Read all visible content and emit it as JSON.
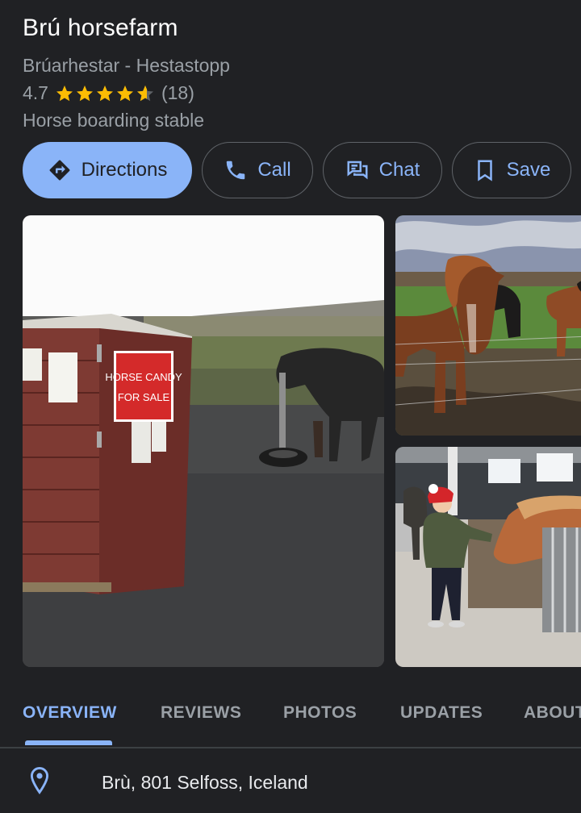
{
  "place": {
    "name": "Brú horsefarm",
    "alt_name": "Brúarhestar - Hestastopp",
    "rating": "4.7",
    "review_count": "(18)",
    "stars_filled": 4.7,
    "category": "Horse boarding stable"
  },
  "actions": {
    "directions": "Directions",
    "call": "Call",
    "chat": "Chat",
    "save": "Save"
  },
  "photos": {
    "sign_line1": "HORSE CANDY",
    "sign_line2": "FOR SALE"
  },
  "tabs": [
    "OVERVIEW",
    "REVIEWS",
    "PHOTOS",
    "UPDATES",
    "ABOUT"
  ],
  "active_tab": "OVERVIEW",
  "address": "Brù, 801 Selfoss, Iceland",
  "colors": {
    "background": "#202124",
    "accent": "#8ab4f8",
    "star": "#fbbc04",
    "secondary_text": "#9aa0a6"
  },
  "icons": {
    "directions": "directions-icon",
    "call": "phone-icon",
    "chat": "chat-icon",
    "save": "bookmark-icon",
    "address": "location-pin-icon"
  }
}
